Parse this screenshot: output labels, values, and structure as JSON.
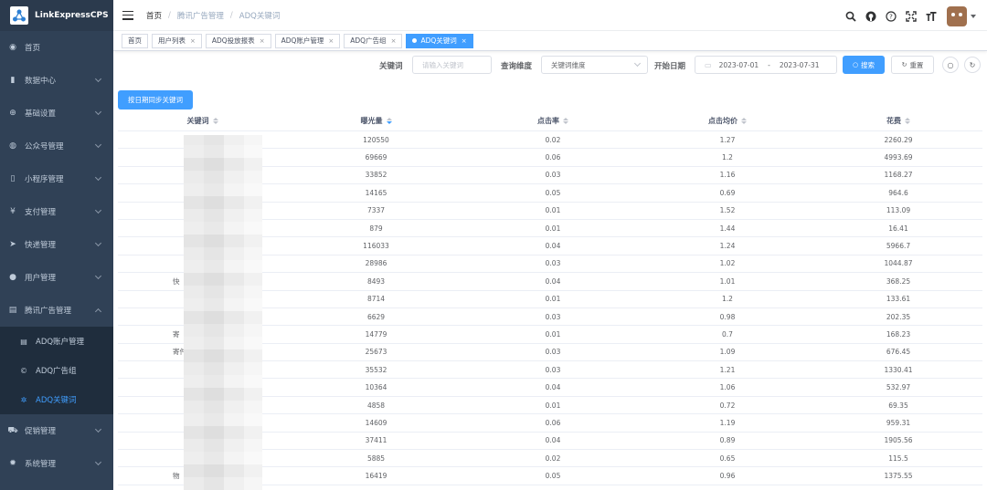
{
  "app": {
    "name": "LinkExpressCPS"
  },
  "sidebar": {
    "items": [
      {
        "label": "首页",
        "icon": "dashboard-icon",
        "glyph": "◉"
      },
      {
        "label": "数据中心",
        "icon": "chart-icon",
        "glyph": "▮"
      },
      {
        "label": "基础设置",
        "icon": "settings-icon",
        "glyph": "⊕"
      },
      {
        "label": "公众号管理",
        "icon": "wechat-icon",
        "glyph": "◍"
      },
      {
        "label": "小程序管理",
        "icon": "mobile-icon",
        "glyph": "▯"
      },
      {
        "label": "支付管理",
        "icon": "yen-icon",
        "glyph": "¥"
      },
      {
        "label": "快递管理",
        "icon": "send-icon",
        "glyph": "➤"
      },
      {
        "label": "用户管理",
        "icon": "user-icon",
        "glyph": "●"
      },
      {
        "label": "腾讯广告管理",
        "icon": "document-icon",
        "glyph": "▤"
      }
    ],
    "submenu": [
      {
        "label": "ADQ账户管理",
        "glyph": "▤",
        "active": false
      },
      {
        "label": "ADQ广告组",
        "glyph": "©",
        "active": false
      },
      {
        "label": "ADQ关键词",
        "glyph": "✲",
        "active": true
      }
    ],
    "bottom": [
      {
        "label": "促销管理",
        "icon": "cart-icon",
        "glyph": "⛟"
      },
      {
        "label": "系统管理",
        "icon": "gear-icon",
        "glyph": "✹"
      }
    ]
  },
  "breadcrumb": [
    "首页",
    "腾讯广告管理",
    "ADQ关键词"
  ],
  "tags": [
    {
      "label": "首页",
      "closable": false
    },
    {
      "label": "用户列表",
      "closable": true
    },
    {
      "label": "ADQ投放报表",
      "closable": true
    },
    {
      "label": "ADQ账户管理",
      "closable": true
    },
    {
      "label": "ADQ广告组",
      "closable": true
    },
    {
      "label": "ADQ关键词",
      "closable": true,
      "active": true
    }
  ],
  "filter": {
    "keyword_label": "关键词",
    "keyword_placeholder": "请输入关键词",
    "dimension_label": "查询维度",
    "dimension_value": "关键词维度",
    "date_label": "开始日期",
    "date_start": "2023-07-01",
    "date_sep": "-",
    "date_end": "2023-07-31",
    "search_btn": "搜索",
    "reset_btn": "重置"
  },
  "sync_button": "按日期同步关键词",
  "table": {
    "headers": [
      "关键词",
      "曝光量",
      "点击率",
      "点击均价",
      "花费"
    ],
    "rows": [
      [
        "",
        "120550",
        "0.02",
        "1.27",
        "2260.29"
      ],
      [
        "",
        "69669",
        "0.06",
        "1.2",
        "4993.69"
      ],
      [
        "",
        "33852",
        "0.03",
        "1.16",
        "1168.27"
      ],
      [
        "",
        "14165",
        "0.05",
        "0.69",
        "964.6"
      ],
      [
        "",
        "7337",
        "0.01",
        "1.52",
        "113.09"
      ],
      [
        "",
        "879",
        "0.01",
        "1.44",
        "16.41"
      ],
      [
        "",
        "116033",
        "0.04",
        "1.24",
        "5966.7"
      ],
      [
        "",
        "28986",
        "0.03",
        "1.02",
        "1044.87"
      ],
      [
        "快",
        "8493",
        "0.04",
        "1.01",
        "368.25"
      ],
      [
        "",
        "8714",
        "0.01",
        "1.2",
        "133.61"
      ],
      [
        "",
        "6629",
        "0.03",
        "0.98",
        "202.35"
      ],
      [
        "寄",
        "14779",
        "0.01",
        "0.7",
        "168.23"
      ],
      [
        "寄件",
        "25673",
        "0.03",
        "1.09",
        "676.45"
      ],
      [
        "",
        "35532",
        "0.03",
        "1.21",
        "1330.41"
      ],
      [
        "",
        "10364",
        "0.04",
        "1.06",
        "532.97"
      ],
      [
        "",
        "4858",
        "0.01",
        "0.72",
        "69.35"
      ],
      [
        "",
        "14609",
        "0.06",
        "1.19",
        "959.31"
      ],
      [
        "",
        "37411",
        "0.04",
        "0.89",
        "1905.56"
      ],
      [
        "",
        "5885",
        "0.02",
        "0.65",
        "115.5"
      ],
      [
        "物",
        "16419",
        "0.05",
        "0.96",
        "1375.55"
      ]
    ]
  }
}
